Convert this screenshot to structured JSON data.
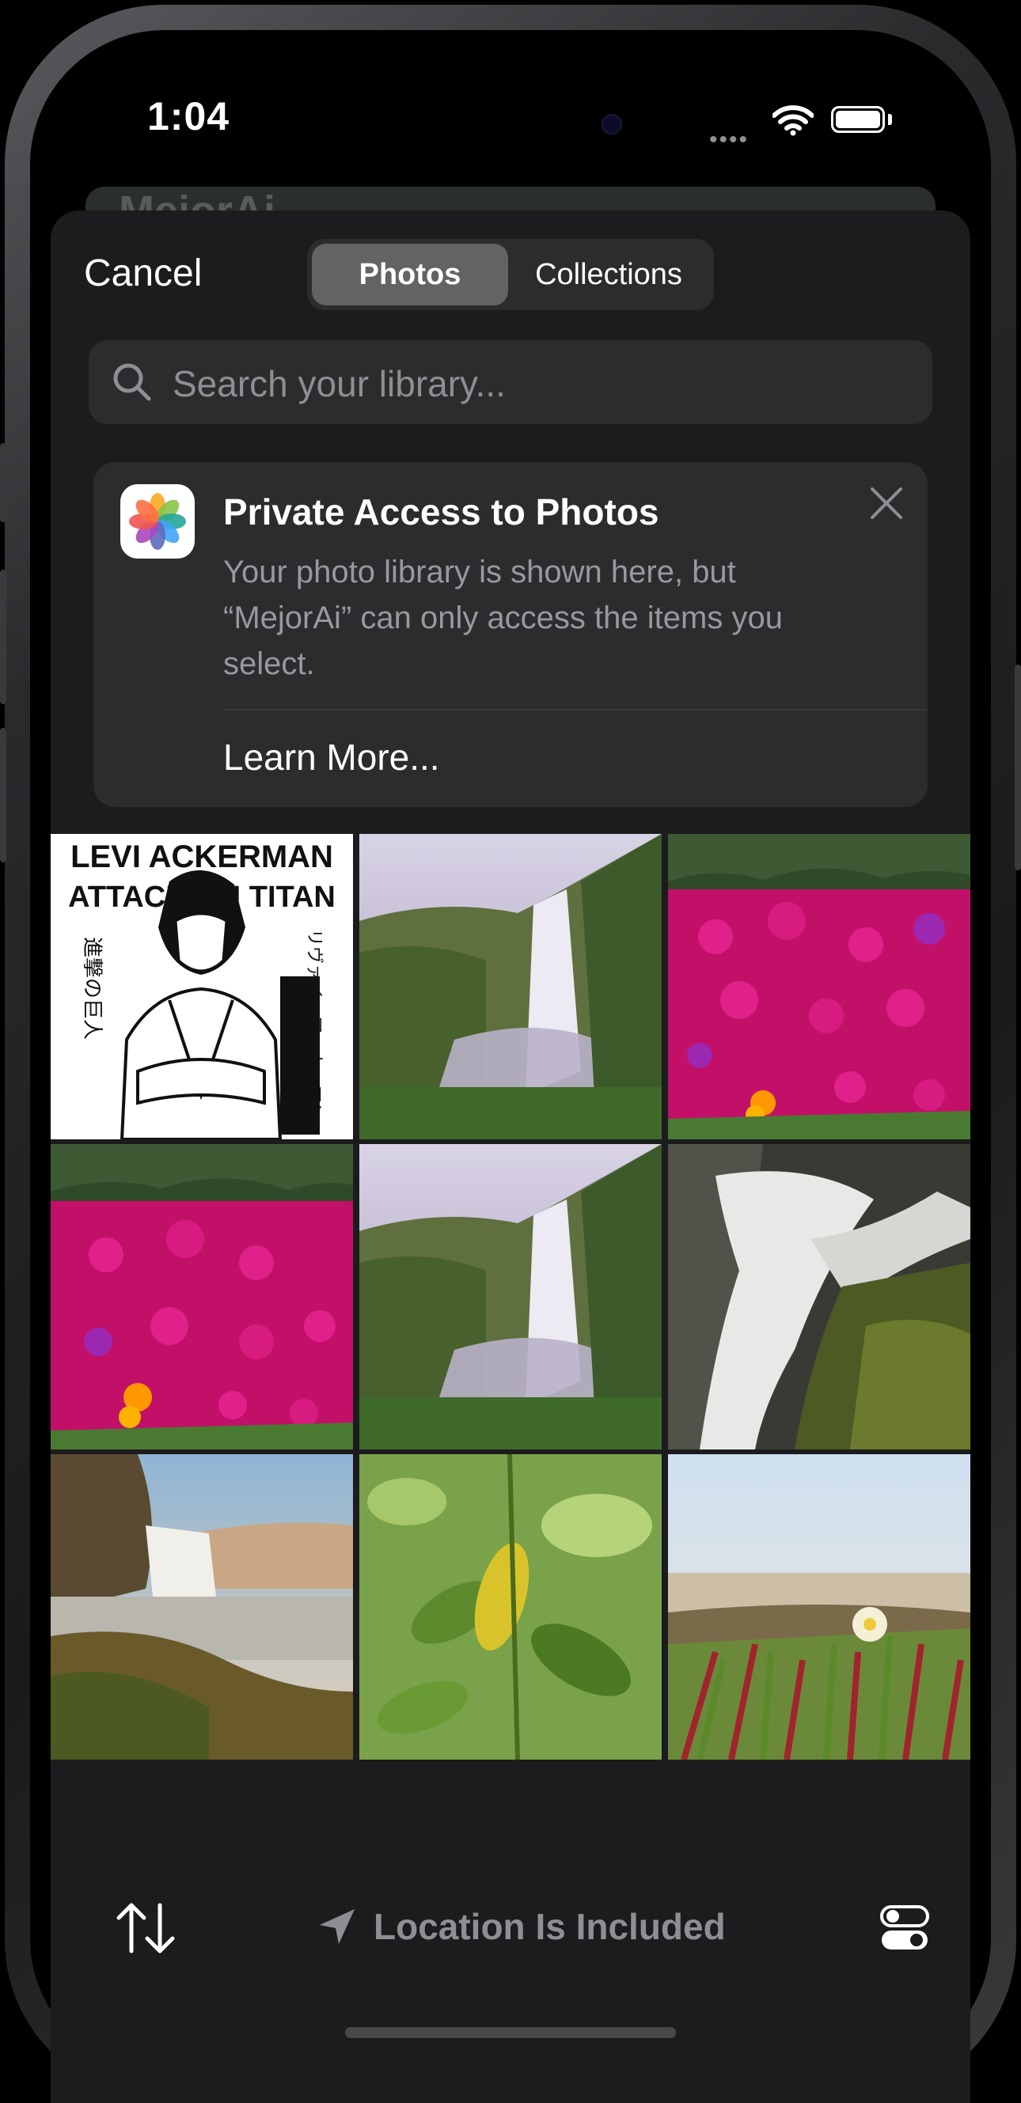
{
  "status_bar": {
    "time": "1:04",
    "signal_dots": "••••"
  },
  "background_app": {
    "title": "MejorAi"
  },
  "picker": {
    "cancel_label": "Cancel",
    "tabs": [
      {
        "label": "Photos",
        "selected": true
      },
      {
        "label": "Collections",
        "selected": false
      }
    ],
    "search_placeholder": "Search your library..."
  },
  "banner": {
    "title": "Private Access to Photos",
    "body": "Your photo library is shown here, but “MejorAi” can only access the items you select.",
    "link": "Learn More..."
  },
  "photos": [
    {
      "name": "photo-levi-ackerman-poster",
      "header_text": "LEVI ACKERMAN",
      "subheader_text": "ATTACK ON TITAN",
      "vertical_text_left": "進撃の巨人",
      "vertical_text_right": "リヴァイ・アッカーマン"
    },
    {
      "name": "photo-waterfall-cliff"
    },
    {
      "name": "photo-magenta-flowers"
    },
    {
      "name": "photo-magenta-flowers-2"
    },
    {
      "name": "photo-waterfall-cliff-2"
    },
    {
      "name": "photo-waterfall-rocks"
    },
    {
      "name": "photo-waterfall-canyon"
    },
    {
      "name": "photo-green-leaves"
    },
    {
      "name": "photo-beach-flower"
    }
  ],
  "toolbar": {
    "location_label": "Location Is Included",
    "sort_icon": "sort-arrows-icon",
    "options_icon": "toggles-icon"
  },
  "colors": {
    "sheet": "#1c1c1e",
    "control": "#2c2c2e",
    "selected_segment": "#636366",
    "secondary_text": "#8e8e93"
  }
}
